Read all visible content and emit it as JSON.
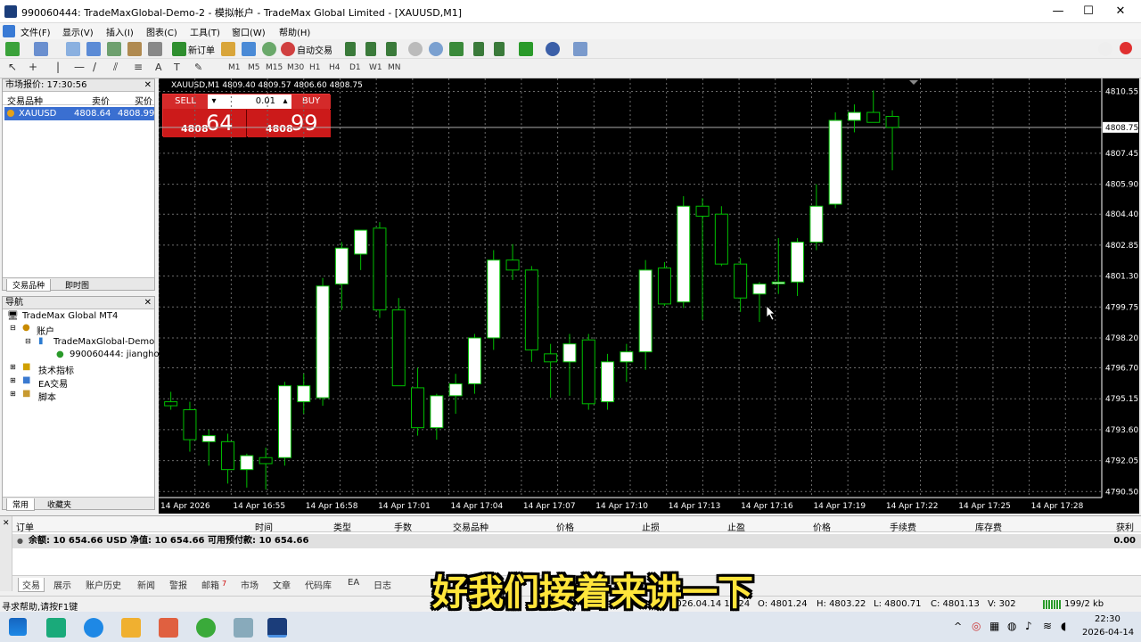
{
  "window": {
    "title": "990060444: TradeMaxGlobal-Demo-2 - 模拟帐户 - TradeMax Global Limited - [XAUUSD,M1]"
  },
  "menu": [
    "文件(F)",
    "显示(V)",
    "插入(I)",
    "图表(C)",
    "工具(T)",
    "窗口(W)",
    "帮助(H)"
  ],
  "toolbar": {
    "new_order": "新订单",
    "auto_trade": "自动交易",
    "timeframes": [
      "M1",
      "M5",
      "M15",
      "M30",
      "H1",
      "H4",
      "D1",
      "W1",
      "MN"
    ]
  },
  "market_watch": {
    "title": "市场报价: 17:30:56",
    "columns": [
      "交易品种",
      "卖价",
      "买价"
    ],
    "rows": [
      {
        "symbol": "XAUUSD",
        "bid": "4808.64",
        "ask": "4808.99"
      }
    ],
    "tabs": [
      "交易品种",
      "即时图"
    ]
  },
  "navigator": {
    "title": "导航",
    "items": [
      "TradeMax Global MT4",
      "账户",
      "TradeMaxGlobal-Demo",
      "990060444: jiangho",
      "技术指标",
      "EA交易",
      "脚本"
    ],
    "tabs": [
      "常用",
      "收藏夹"
    ]
  },
  "chart": {
    "header": "XAUUSD,M1  4809.40 4809.57 4806.60 4808.75",
    "sell_label": "SELL",
    "buy_label": "BUY",
    "lot": "0.01",
    "sell_prefix": "4808",
    "sell_big": "64",
    "buy_prefix": "4808",
    "buy_big": "99",
    "current_price_label": "4808.75"
  },
  "chart_data": {
    "type": "candlestick",
    "symbol": "XAUUSD",
    "timeframe": "M1",
    "y_ticks": [
      "4810.55",
      "4808.75",
      "4807.45",
      "4805.90",
      "4804.40",
      "4802.85",
      "4801.30",
      "4799.75",
      "4798.20",
      "4796.70",
      "4795.15",
      "4793.60",
      "4792.05",
      "4790.50"
    ],
    "x_ticks": [
      "14 Apr 2026",
      "14 Apr 16:55",
      "14 Apr 16:58",
      "14 Apr 17:01",
      "14 Apr 17:04",
      "14 Apr 17:07",
      "14 Apr 17:10",
      "14 Apr 17:13",
      "14 Apr 17:16",
      "14 Apr 17:19",
      "14 Apr 17:22",
      "14 Apr 17:25",
      "14 Apr 17:28"
    ],
    "ylim": [
      4790.2,
      4811.2
    ],
    "candles": [
      {
        "o": 4795.0,
        "h": 4795.5,
        "l": 4794.6,
        "c": 4794.8
      },
      {
        "o": 4794.6,
        "h": 4795.0,
        "l": 4792.5,
        "c": 4793.1
      },
      {
        "o": 4793.0,
        "h": 4793.6,
        "l": 4791.8,
        "c": 4793.3
      },
      {
        "o": 4793.0,
        "h": 4793.4,
        "l": 4790.9,
        "c": 4791.6
      },
      {
        "o": 4791.6,
        "h": 4792.4,
        "l": 4790.7,
        "c": 4792.3
      },
      {
        "o": 4792.2,
        "h": 4792.7,
        "l": 4790.6,
        "c": 4791.9
      },
      {
        "o": 4792.2,
        "h": 4796.0,
        "l": 4791.8,
        "c": 4795.8
      },
      {
        "o": 4795.0,
        "h": 4796.4,
        "l": 4794.4,
        "c": 4795.8
      },
      {
        "o": 4795.2,
        "h": 4801.2,
        "l": 4794.8,
        "c": 4800.8
      },
      {
        "o": 4800.9,
        "h": 4803.0,
        "l": 4799.6,
        "c": 4802.7
      },
      {
        "o": 4802.4,
        "h": 4803.6,
        "l": 4801.6,
        "c": 4803.6
      },
      {
        "o": 4803.7,
        "h": 4804.0,
        "l": 4799.2,
        "c": 4799.6
      },
      {
        "o": 4799.6,
        "h": 4800.2,
        "l": 4795.9,
        "c": 4795.8
      },
      {
        "o": 4795.7,
        "h": 4796.7,
        "l": 4793.3,
        "c": 4793.7
      },
      {
        "o": 4793.7,
        "h": 4795.4,
        "l": 4793.1,
        "c": 4795.3
      },
      {
        "o": 4795.3,
        "h": 4796.4,
        "l": 4794.4,
        "c": 4795.9
      },
      {
        "o": 4795.9,
        "h": 4798.4,
        "l": 4795.4,
        "c": 4798.2
      },
      {
        "o": 4798.2,
        "h": 4802.6,
        "l": 4797.6,
        "c": 4802.1
      },
      {
        "o": 4802.1,
        "h": 4802.9,
        "l": 4801.1,
        "c": 4801.6
      },
      {
        "o": 4801.6,
        "h": 4801.8,
        "l": 4797.0,
        "c": 4797.6
      },
      {
        "o": 4797.4,
        "h": 4797.9,
        "l": 4795.2,
        "c": 4797.0
      },
      {
        "o": 4797.0,
        "h": 4798.4,
        "l": 4795.3,
        "c": 4797.9
      },
      {
        "o": 4798.1,
        "h": 4798.4,
        "l": 4794.6,
        "c": 4794.9
      },
      {
        "o": 4795.0,
        "h": 4797.4,
        "l": 4794.6,
        "c": 4797.0
      },
      {
        "o": 4797.0,
        "h": 4797.9,
        "l": 4796.0,
        "c": 4797.5
      },
      {
        "o": 4797.5,
        "h": 4802.1,
        "l": 4796.6,
        "c": 4801.6
      },
      {
        "o": 4801.7,
        "h": 4802.0,
        "l": 4799.8,
        "c": 4799.9
      },
      {
        "o": 4800.0,
        "h": 4805.3,
        "l": 4799.7,
        "c": 4804.8
      },
      {
        "o": 4804.8,
        "h": 4805.2,
        "l": 4799.1,
        "c": 4804.3
      },
      {
        "o": 4804.4,
        "h": 4804.8,
        "l": 4801.8,
        "c": 4801.9
      },
      {
        "o": 4801.9,
        "h": 4802.2,
        "l": 4799.5,
        "c": 4800.2
      },
      {
        "o": 4800.4,
        "h": 4801.0,
        "l": 4799.0,
        "c": 4800.9
      },
      {
        "o": 4801.0,
        "h": 4803.2,
        "l": 4800.4,
        "c": 4801.0
      },
      {
        "o": 4801.0,
        "h": 4803.2,
        "l": 4800.3,
        "c": 4803.0
      },
      {
        "o": 4803.0,
        "h": 4805.9,
        "l": 4802.6,
        "c": 4804.8
      },
      {
        "o": 4804.9,
        "h": 4809.5,
        "l": 4804.7,
        "c": 4809.1
      },
      {
        "o": 4809.1,
        "h": 4809.9,
        "l": 4808.5,
        "c": 4809.5
      },
      {
        "o": 4809.5,
        "h": 4810.6,
        "l": 4809.0,
        "c": 4809.0
      },
      {
        "o": 4809.3,
        "h": 4809.6,
        "l": 4806.6,
        "c": 4808.75
      }
    ]
  },
  "terminal": {
    "columns": [
      "订单",
      "时间",
      "类型",
      "手数",
      "交易品种",
      "价格",
      "止损",
      "止盈",
      "价格",
      "手续费",
      "库存费",
      "获利"
    ],
    "balance_text": "余额: 10 654.66 USD  净值: 10 654.66  可用预付款: 10 654.66",
    "profit": "0.00",
    "tabs": [
      "交易",
      "展示",
      "账户历史",
      "新闻",
      "警报",
      "邮箱",
      "市场",
      "文章",
      "代码库",
      "EA",
      "日志"
    ],
    "mail_count": "7"
  },
  "statusbar": {
    "help": "寻求帮助,请按F1键",
    "date": "2026.04.14 17:24",
    "open": "O: 4801.24",
    "high": "H: 4803.22",
    "low": "L: 4800.71",
    "close": "C: 4801.13",
    "volume": "V: 302",
    "traffic": "199/2 kb"
  },
  "taskbar": {
    "time": "22:30",
    "date": "2026-04-14"
  },
  "subtitle": "好我们接着来讲一下",
  "colors": {
    "chart_bg": "#000000",
    "bull": "#ffffff",
    "bear": "#000000",
    "wick": "#00c000",
    "grid": "#6b6b6b",
    "sell": "#cc1a1a",
    "buy": "#cc1a1a",
    "subtitle": "#ffe53b"
  }
}
